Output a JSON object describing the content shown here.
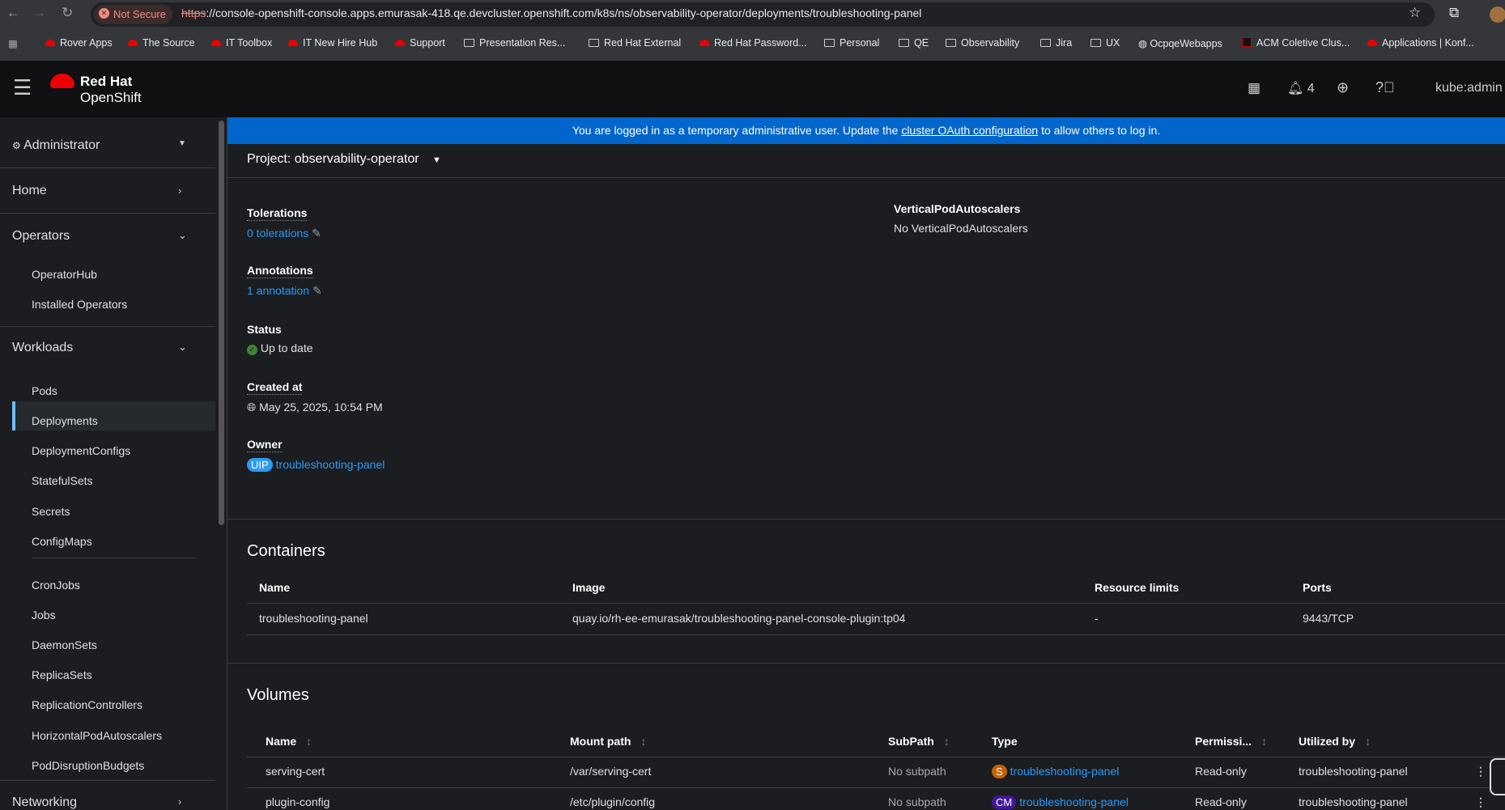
{
  "browser": {
    "not_secure": "Not Secure",
    "url_scheme": "https",
    "url_rest": "://console-openshift-console.apps.emurasak-418.qe.devcluster.openshift.com/k8s/ns/observability-operator/deployments/troubleshooting-panel",
    "bookmarks": [
      {
        "label": "Rover Apps",
        "icon": "redhat"
      },
      {
        "label": "The Source",
        "icon": "redhat"
      },
      {
        "label": "IT Toolbox",
        "icon": "redhat"
      },
      {
        "label": "IT New Hire Hub",
        "icon": "redhat"
      },
      {
        "label": "Support",
        "icon": "redhat"
      },
      {
        "label": "Presentation Res...",
        "icon": "folder"
      },
      {
        "label": "Red Hat External",
        "icon": "folder"
      },
      {
        "label": "Red Hat Password...",
        "icon": "redhat"
      },
      {
        "label": "Personal",
        "icon": "folder"
      },
      {
        "label": "QE",
        "icon": "folder"
      },
      {
        "label": "Observability",
        "icon": "folder"
      },
      {
        "label": "Jira",
        "icon": "folder"
      },
      {
        "label": "UX",
        "icon": "folder"
      },
      {
        "label": "OcpqeWebapps",
        "icon": "globe"
      },
      {
        "label": "ACM Coletive Clus...",
        "icon": "openshift"
      },
      {
        "label": "Applications | Konf...",
        "icon": "redhat"
      }
    ]
  },
  "masthead": {
    "brand_top": "Red Hat",
    "brand_bottom": "OpenShift",
    "notifications": "4",
    "user": "kube:admin"
  },
  "sidebar": {
    "perspective": "Administrator",
    "home": "Home",
    "operators": "Operators",
    "operator_items": [
      "OperatorHub",
      "Installed Operators"
    ],
    "workloads": "Workloads",
    "workload_items": [
      "Pods",
      "Deployments",
      "DeploymentConfigs",
      "StatefulSets",
      "Secrets",
      "ConfigMaps"
    ],
    "workload_items2": [
      "CronJobs",
      "Jobs",
      "DaemonSets",
      "ReplicaSets",
      "ReplicationControllers",
      "HorizontalPodAutoscalers",
      "PodDisruptionBudgets"
    ],
    "networking": "Networking",
    "active": "Deployments"
  },
  "banner": {
    "before": "You are logged in as a temporary administrative user. Update the ",
    "link": "cluster OAuth configuration",
    "after": " to allow others to log in."
  },
  "project": {
    "label": "Project: observability-operator"
  },
  "details": {
    "tolerations_label": "Tolerations",
    "tolerations_value": "0 tolerations",
    "annotations_label": "Annotations",
    "annotations_value": "1 annotation",
    "status_label": "Status",
    "status_value": "Up to date",
    "created_label": "Created at",
    "created_value": "May 25, 2025, 10:54 PM",
    "owner_label": "Owner",
    "owner_badge": "UIP",
    "owner_value": "troubleshooting-panel",
    "vpa_label": "VerticalPodAutoscalers",
    "vpa_value": "No VerticalPodAutoscalers"
  },
  "containers": {
    "title": "Containers",
    "headers": [
      "Name",
      "Image",
      "Resource limits",
      "Ports"
    ],
    "rows": [
      [
        "troubleshooting-panel",
        "quay.io/rh-ee-emurasak/troubleshooting-panel-console-plugin:tp04",
        "-",
        "9443/TCP"
      ]
    ]
  },
  "volumes": {
    "title": "Volumes",
    "headers": [
      "Name",
      "Mount path",
      "SubPath",
      "Type",
      "Permissi...",
      "Utilized by"
    ],
    "rows": [
      {
        "name": "serving-cert",
        "mount": "/var/serving-cert",
        "subpath": "No subpath",
        "type_badge": "S",
        "type_color": "#c46100",
        "type": "troubleshooting-panel",
        "perm": "Read-only",
        "used": "troubleshooting-panel"
      },
      {
        "name": "plugin-config",
        "mount": "/etc/plugin/config",
        "subpath": "No subpath",
        "type_badge": "CM",
        "type_color": "#40199a",
        "type": "troubleshooting-panel",
        "perm": "Read-only",
        "used": "troubleshooting-panel"
      }
    ]
  }
}
